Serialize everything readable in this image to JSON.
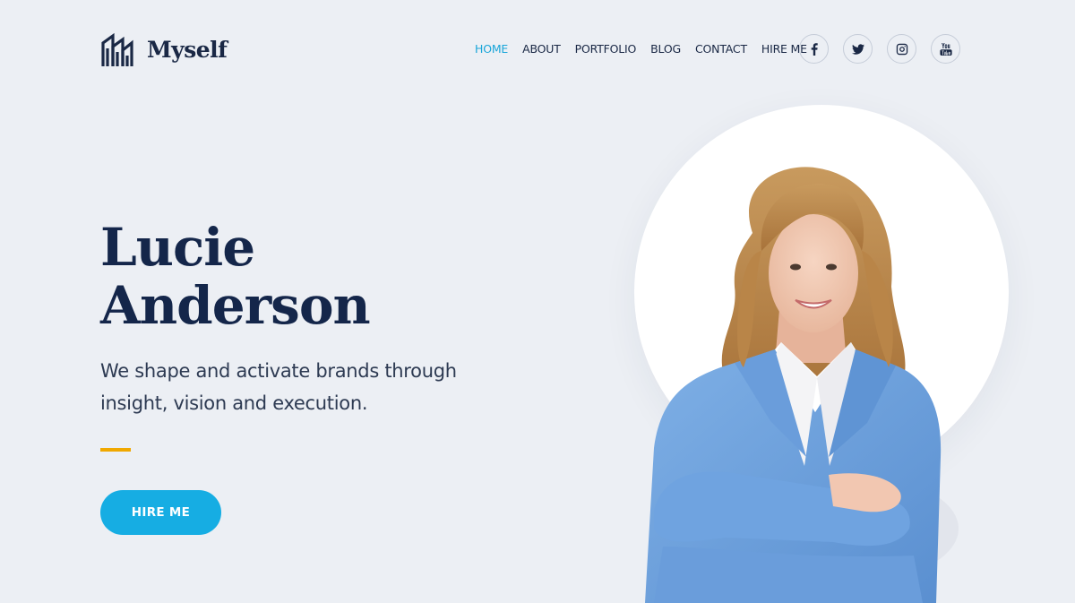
{
  "brand": {
    "name": "Myself",
    "logo_icon": "stacked-arch-logo-icon"
  },
  "nav": {
    "items": [
      {
        "label": "HOME",
        "active": true
      },
      {
        "label": "ABOUT",
        "active": false
      },
      {
        "label": "PORTFOLIO",
        "active": false
      },
      {
        "label": "BLOG",
        "active": false
      },
      {
        "label": "CONTACT",
        "active": false
      },
      {
        "label": "HIRE ME",
        "active": false
      }
    ],
    "active_color": "#1aa6d9"
  },
  "social": [
    {
      "icon": "facebook-icon"
    },
    {
      "icon": "twitter-icon"
    },
    {
      "icon": "instagram-icon"
    },
    {
      "icon": "youtube-icon"
    }
  ],
  "hero": {
    "first_name": "Lucie",
    "last_name": "Anderson",
    "tagline": "We shape and activate brands through insight, vision and execution.",
    "cta_label": "HIRE ME",
    "accent_color": "#f0a800",
    "cta_color": "#16ade3"
  }
}
